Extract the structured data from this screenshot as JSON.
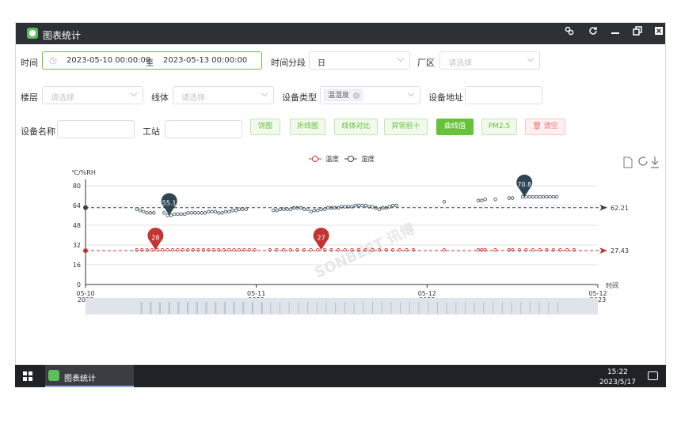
{
  "window": {
    "title": "图表统计"
  },
  "filters": {
    "time_label": "时间",
    "start_date": "2023-05-10 00:00:00",
    "range_sep": "至",
    "end_date": "2023-05-13 00:00:00",
    "segment_label": "时间分段",
    "segment_value": "日",
    "area_label": "厂区",
    "area_placeholder": "请选择",
    "floor_label": "楼层",
    "floor_placeholder": "请选择",
    "line_label": "线体",
    "line_placeholder": "请选择",
    "device_type_label": "设备类型",
    "device_type_tag": "温湿度",
    "device_addr_label": "设备地址",
    "device_name_label": "设备名称",
    "station_label": "工站"
  },
  "buttons": {
    "pie": "饼图",
    "line": "折线图",
    "line_compare": "线体对比",
    "abnormal_top10": "异常前十",
    "curve": "曲线值",
    "pm25": "PM2.5",
    "clear": "清空"
  },
  "colors": {
    "temp": "#c23531",
    "humidity": "#2f4554",
    "accent": "#67c23a"
  },
  "chart_data": {
    "type": "scatter",
    "legend": [
      "温度",
      "湿度"
    ],
    "legend_position": "top-center",
    "ylabel": "℃/%RH",
    "xlabel": "时间",
    "ylim": [
      0,
      80
    ],
    "yticks": [
      0,
      16,
      32,
      48,
      64,
      80
    ],
    "xticks": [
      {
        "label": "05-10",
        "sub": "2023"
      },
      {
        "label": "05-11",
        "sub": "2023"
      },
      {
        "label": "05-12",
        "sub": "2023"
      },
      {
        "label": "05-12",
        "sub": "2023"
      }
    ],
    "grid": true,
    "series": [
      {
        "name": "温度",
        "color": "#c23531",
        "average": 27.43,
        "max_label": "28",
        "max2_label": "27",
        "values": [
          [
            0.3,
            28
          ],
          [
            0.33,
            28
          ],
          [
            0.36,
            28
          ],
          [
            0.39,
            28
          ],
          [
            0.42,
            28
          ],
          [
            0.45,
            28
          ],
          [
            0.48,
            28
          ],
          [
            0.51,
            28
          ],
          [
            0.54,
            28
          ],
          [
            0.57,
            28
          ],
          [
            0.6,
            28
          ],
          [
            0.63,
            28
          ],
          [
            0.66,
            28
          ],
          [
            0.69,
            28
          ],
          [
            0.72,
            28
          ],
          [
            0.75,
            28
          ],
          [
            0.78,
            28
          ],
          [
            0.81,
            28
          ],
          [
            0.84,
            28
          ],
          [
            0.87,
            28
          ],
          [
            0.9,
            28
          ],
          [
            0.93,
            28
          ],
          [
            0.96,
            28
          ],
          [
            0.99,
            28
          ],
          [
            1.08,
            28
          ],
          [
            1.12,
            28
          ],
          [
            1.16,
            28
          ],
          [
            1.2,
            28
          ],
          [
            1.24,
            28
          ],
          [
            1.28,
            28
          ],
          [
            1.32,
            28
          ],
          [
            1.36,
            28
          ],
          [
            1.4,
            28
          ],
          [
            1.44,
            28
          ],
          [
            1.48,
            28
          ],
          [
            1.52,
            28
          ],
          [
            1.56,
            28
          ],
          [
            1.6,
            28
          ],
          [
            1.64,
            28
          ],
          [
            1.68,
            28
          ],
          [
            1.72,
            28
          ],
          [
            1.76,
            28
          ],
          [
            1.8,
            28
          ],
          [
            1.84,
            28
          ],
          [
            1.88,
            28
          ],
          [
            1.92,
            28
          ],
          [
            2.1,
            28
          ],
          [
            2.3,
            28
          ],
          [
            2.32,
            28
          ],
          [
            2.34,
            28
          ],
          [
            2.4,
            28
          ],
          [
            2.48,
            28
          ],
          [
            2.5,
            28
          ],
          [
            2.54,
            28
          ],
          [
            2.58,
            28
          ],
          [
            2.62,
            28
          ],
          [
            2.66,
            28
          ],
          [
            2.7,
            28
          ],
          [
            2.74,
            28
          ],
          [
            2.78,
            28
          ],
          [
            2.82,
            28
          ],
          [
            2.86,
            28
          ]
        ]
      },
      {
        "name": "湿度",
        "color": "#2f4554",
        "average": 62.21,
        "max_label": "70.8",
        "min_label": "55.1",
        "values": [
          [
            0.3,
            61
          ],
          [
            0.32,
            60
          ],
          [
            0.34,
            59
          ],
          [
            0.36,
            58
          ],
          [
            0.38,
            58
          ],
          [
            0.4,
            58
          ],
          [
            0.46,
            58
          ],
          [
            0.48,
            56
          ],
          [
            0.5,
            56
          ],
          [
            0.52,
            57
          ],
          [
            0.54,
            57
          ],
          [
            0.56,
            57
          ],
          [
            0.58,
            57
          ],
          [
            0.6,
            58
          ],
          [
            0.62,
            58
          ],
          [
            0.64,
            58
          ],
          [
            0.66,
            58
          ],
          [
            0.68,
            58
          ],
          [
            0.7,
            58
          ],
          [
            0.72,
            59
          ],
          [
            0.74,
            59
          ],
          [
            0.76,
            59
          ],
          [
            0.78,
            58
          ],
          [
            0.8,
            58
          ],
          [
            0.82,
            59
          ],
          [
            0.84,
            59
          ],
          [
            0.86,
            60
          ],
          [
            0.88,
            60
          ],
          [
            0.9,
            61
          ],
          [
            0.92,
            61
          ],
          [
            0.94,
            61
          ],
          [
            1.1,
            60
          ],
          [
            1.12,
            60
          ],
          [
            1.14,
            61
          ],
          [
            1.16,
            61
          ],
          [
            1.18,
            61
          ],
          [
            1.2,
            61
          ],
          [
            1.22,
            62
          ],
          [
            1.24,
            62
          ],
          [
            1.26,
            62
          ],
          [
            1.28,
            61
          ],
          [
            1.3,
            61
          ],
          [
            1.32,
            59
          ],
          [
            1.34,
            60
          ],
          [
            1.36,
            60
          ],
          [
            1.38,
            61
          ],
          [
            1.4,
            61
          ],
          [
            1.42,
            62
          ],
          [
            1.44,
            62
          ],
          [
            1.46,
            62
          ],
          [
            1.48,
            62
          ],
          [
            1.5,
            63
          ],
          [
            1.52,
            63
          ],
          [
            1.54,
            63
          ],
          [
            1.56,
            63
          ],
          [
            1.58,
            64
          ],
          [
            1.6,
            64
          ],
          [
            1.62,
            64
          ],
          [
            1.64,
            64
          ],
          [
            1.66,
            63
          ],
          [
            1.68,
            63
          ],
          [
            1.7,
            62
          ],
          [
            1.72,
            61
          ],
          [
            1.74,
            62
          ],
          [
            1.76,
            62
          ],
          [
            1.78,
            63
          ],
          [
            1.8,
            64
          ],
          [
            1.82,
            64
          ],
          [
            2.1,
            67
          ],
          [
            2.3,
            68
          ],
          [
            2.32,
            68
          ],
          [
            2.34,
            69
          ],
          [
            2.4,
            69
          ],
          [
            2.48,
            70
          ],
          [
            2.5,
            70
          ],
          [
            2.56,
            71
          ],
          [
            2.58,
            71
          ],
          [
            2.6,
            71
          ],
          [
            2.62,
            71
          ],
          [
            2.64,
            71
          ],
          [
            2.66,
            71
          ],
          [
            2.68,
            71
          ],
          [
            2.7,
            71
          ],
          [
            2.72,
            71
          ],
          [
            2.74,
            71
          ],
          [
            2.76,
            71
          ]
        ]
      }
    ],
    "x_domain": [
      0,
      3
    ]
  },
  "watermark": "SONBEST 讯博",
  "taskbar": {
    "app": "图表统计",
    "time": "15:22",
    "date": "2023/5/17"
  }
}
